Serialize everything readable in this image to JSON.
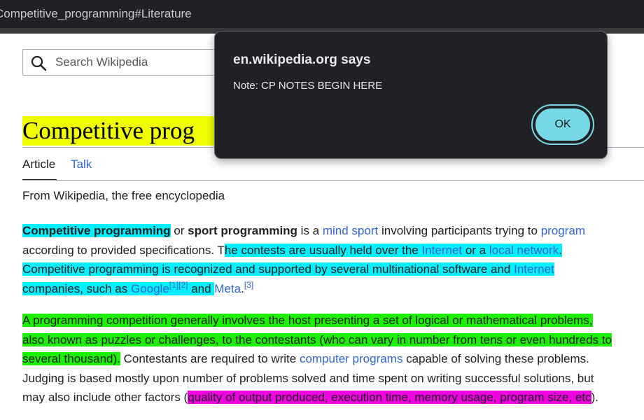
{
  "browser": {
    "url_fragment": "Competitive_programming#Literature"
  },
  "search": {
    "placeholder": "Search Wikipedia"
  },
  "page": {
    "title": "Competitive prog"
  },
  "tabs": {
    "article": "Article",
    "talk": "Talk"
  },
  "tagline": "From Wikipedia, the free encyclopedia",
  "paragraph1": {
    "l1a": "Competitive programming",
    "l1b": " or ",
    "l1c": "sport programming",
    "l1d": " is a ",
    "l1e": "mind sport",
    "l1f": " involving participants trying to ",
    "l1g": "program",
    "l2a": "according to provided specifications. T",
    "l2b": "he contests are usually held over the ",
    "l2c": "Internet",
    "l2d": " or a ",
    "l2e": "local network",
    "l3a": "Competitive programming is recognized and supported by several multinational software and ",
    "l3b": "Internet",
    "l4a": "companies, such as ",
    "l4b": "Google",
    "l4c": "[1]",
    "l4d": "[2]",
    "l4e": " and ",
    "l4f": "Meta",
    "l4g": ".",
    "l4h": "[3]"
  },
  "paragraph2": {
    "l1": "A programming competition generally involves the host presenting a set of logical or mathematical problems,",
    "l2": "also known as puzzles or challenges, to the contestants (who can vary in number from tens or even hundreds to",
    "l3a": "several thousand).",
    "l3b": " Contestants are required to write ",
    "l3c": "computer programs",
    "l3d": " capable of solving these problems.",
    "l4": "Judging is based mostly upon number of problems solved and time spent on writing successful solutions, but",
    "l5a": "may also include other factors (",
    "l5b": "quality of output produced, execution time, memory usage, program size, etc",
    "l5c": ")."
  },
  "dialog": {
    "title": "en.wikipedia.org says",
    "message": "Note: CP NOTES BEGIN HERE",
    "ok_label": "OK"
  },
  "colors": {
    "title_highlight": "#f0ff00",
    "cyan_highlight": "#00f0ff",
    "green_highlight": "#1cf000",
    "magenta_highlight": "#f000e0",
    "link": "#3366cc",
    "dialog_bg": "#202124",
    "ok_button": "#78d9e6"
  }
}
